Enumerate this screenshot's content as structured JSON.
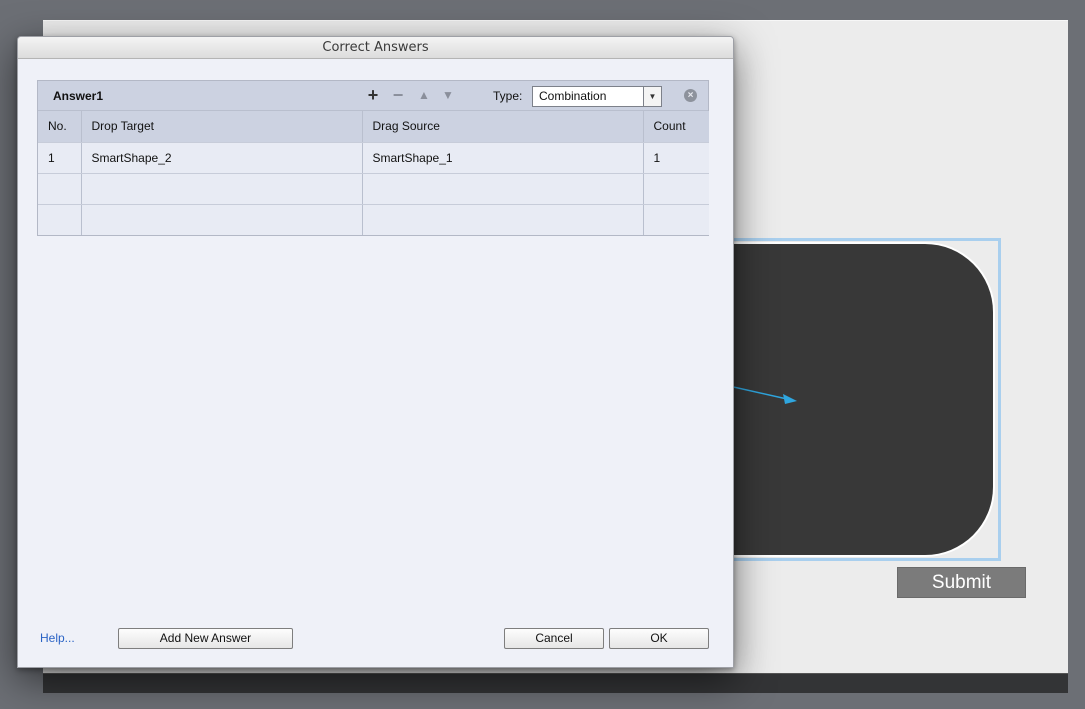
{
  "dialog": {
    "title": "Correct Answers",
    "answer_name": "Answer1",
    "toolbar": {
      "add_icon": "plus-icon",
      "remove_icon": "minus-icon",
      "up_icon": "arrow-up-icon",
      "down_icon": "arrow-down-icon"
    },
    "type_label": "Type:",
    "type_value": "Combination",
    "columns": [
      "No.",
      "Drop Target",
      "Drag Source",
      "Count"
    ],
    "rows": [
      {
        "no": "1",
        "drop_target": "SmartShape_2",
        "drag_source": "SmartShape_1",
        "count": "1"
      },
      {
        "no": "",
        "drop_target": "",
        "drag_source": "",
        "count": ""
      },
      {
        "no": "",
        "drop_target": "",
        "drag_source": "",
        "count": ""
      }
    ],
    "help_label": "Help...",
    "add_new_answer_label": "Add New Answer",
    "cancel_label": "Cancel",
    "ok_label": "OK"
  },
  "stage": {
    "submit_label": "Submit",
    "colors": {
      "shape_fill": "#383838",
      "selection_border": "#a9cfee",
      "arrow": "#2fa6df",
      "link": "#2a63c5"
    }
  }
}
